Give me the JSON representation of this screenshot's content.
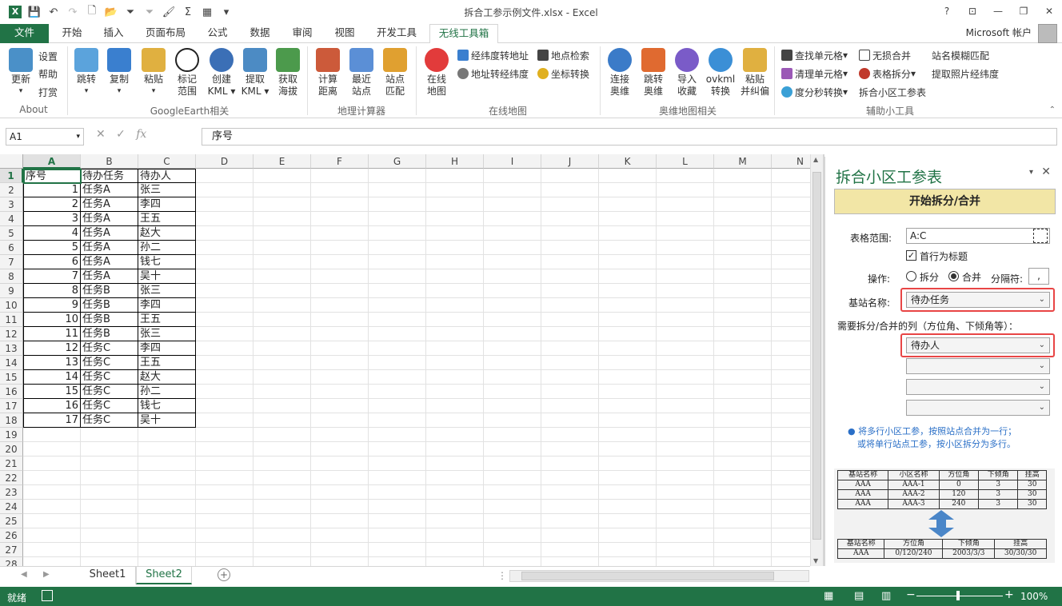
{
  "window": {
    "title": "拆合工参示例文件.xlsx - Excel",
    "account": "Microsoft 帐户"
  },
  "tabs": [
    {
      "label": "文件",
      "name": "tab-file"
    },
    {
      "label": "开始",
      "name": "tab-home"
    },
    {
      "label": "插入",
      "name": "tab-insert"
    },
    {
      "label": "页面布局",
      "name": "tab-page-layout"
    },
    {
      "label": "公式",
      "name": "tab-formulas"
    },
    {
      "label": "数据",
      "name": "tab-data"
    },
    {
      "label": "审阅",
      "name": "tab-review"
    },
    {
      "label": "视图",
      "name": "tab-view"
    },
    {
      "label": "开发工具",
      "name": "tab-developer"
    },
    {
      "label": "无线工具箱",
      "name": "tab-wireless-toolbox"
    }
  ],
  "ribbon": {
    "about": {
      "update": "更新",
      "settings": "设置",
      "help": "帮助",
      "reward": "打赏",
      "group": "About"
    },
    "ge": {
      "jump": "跳转",
      "copy": "复制",
      "paste": "粘贴",
      "mark1": "标记",
      "mark2": "范围",
      "create1": "创建",
      "create2": "KML",
      "extract1": "提取",
      "extract2": "KML",
      "alt1": "获取",
      "alt2": "海拔",
      "group": "GoogleEarth相关"
    },
    "geo": {
      "calc1": "计算",
      "calc2": "距离",
      "near1": "最近",
      "near2": "站点",
      "match1": "站点",
      "match2": "匹配",
      "group": "地理计算器"
    },
    "online": {
      "map1": "在线",
      "map2": "地图",
      "lat2addr": "经纬度转地址",
      "addr2lat": "地址转经纬度",
      "poi": "地点检索",
      "coord": "坐标转换",
      "group": "在线地图"
    },
    "ovi": {
      "conn1": "连接",
      "conn2": "奥维",
      "jump1": "跳转",
      "jump2": "奥维",
      "imp1": "导入",
      "imp2": "收藏",
      "ovk1": "ovkml",
      "ovk2": "转换",
      "paste1": "粘贴",
      "paste2": "并纠偏",
      "group": "奥维地图相关"
    },
    "tools": {
      "find": "查找单元格",
      "clear": "清理单元格",
      "dms": "度分秒转换",
      "lossless": "无损合并",
      "split": "表格拆分",
      "cell": "拆合小区工参表",
      "fuzzy": "站名模糊匹配",
      "photo": "提取照片经纬度",
      "group": "辅助小工具"
    }
  },
  "formula": {
    "cellref": "A1",
    "content": "序号"
  },
  "grid": {
    "columns": [
      "A",
      "B",
      "C",
      "D",
      "E",
      "F",
      "G",
      "H",
      "I",
      "J",
      "K",
      "L",
      "M",
      "N"
    ],
    "rows": [
      "1",
      "2",
      "3",
      "4",
      "5",
      "6",
      "7",
      "8",
      "9",
      "10",
      "11",
      "12",
      "13",
      "14",
      "15",
      "16",
      "17",
      "18",
      "19",
      "20",
      "21",
      "22",
      "23",
      "24",
      "25",
      "26",
      "27",
      "28"
    ],
    "data": [
      [
        "序号",
        "待办任务",
        "待办人"
      ],
      [
        "1",
        "任务A",
        "张三"
      ],
      [
        "2",
        "任务A",
        "李四"
      ],
      [
        "3",
        "任务A",
        "王五"
      ],
      [
        "4",
        "任务A",
        "赵大"
      ],
      [
        "5",
        "任务A",
        "孙二"
      ],
      [
        "6",
        "任务A",
        "钱七"
      ],
      [
        "7",
        "任务A",
        "吴十"
      ],
      [
        "8",
        "任务B",
        "张三"
      ],
      [
        "9",
        "任务B",
        "李四"
      ],
      [
        "10",
        "任务B",
        "王五"
      ],
      [
        "11",
        "任务B",
        "张三"
      ],
      [
        "12",
        "任务C",
        "李四"
      ],
      [
        "13",
        "任务C",
        "王五"
      ],
      [
        "14",
        "任务C",
        "赵大"
      ],
      [
        "15",
        "任务C",
        "孙二"
      ],
      [
        "16",
        "任务C",
        "钱七"
      ],
      [
        "17",
        "任务C",
        "吴十"
      ]
    ]
  },
  "sheets": [
    "Sheet1",
    "Sheet2"
  ],
  "status": {
    "ready": "就绪",
    "zoom": "100%"
  },
  "pane": {
    "title": "拆合小区工参表",
    "start_button": "开始拆分/合并",
    "range_label": "表格范围:",
    "range_value": "A:C",
    "header_checkbox": "首行为标题",
    "op_label": "操作:",
    "op_split": "拆分",
    "op_merge": "合并",
    "sep_label": "分隔符:",
    "sep_value": ",",
    "station_label": "基站名称:",
    "station_value": "待办任务",
    "cols_label": "需要拆分/合并的列（方位角、下倾角等）：",
    "col1": "待办人",
    "note1": "将多行小区工参，按照站点合并为一行；",
    "note2": "或将单行站点工参，按小区拆分为多行。",
    "example_top": {
      "headers": [
        "基站名称",
        "小区名称",
        "方位角",
        "下倾角",
        "挂高"
      ],
      "rows": [
        [
          "AAA",
          "AAA-1",
          "0",
          "3",
          "30"
        ],
        [
          "AAA",
          "AAA-2",
          "120",
          "3",
          "30"
        ],
        [
          "AAA",
          "AAA-3",
          "240",
          "3",
          "30"
        ]
      ]
    },
    "example_bottom": {
      "headers": [
        "基站名称",
        "方位角",
        "下倾角",
        "挂高"
      ],
      "rows": [
        [
          "AAA",
          "0/120/240",
          "2003/3/3",
          "30/30/30"
        ]
      ]
    }
  },
  "colors": {
    "accent": "#217346",
    "highlight": "#e84545",
    "button": "#f2e6a6"
  }
}
